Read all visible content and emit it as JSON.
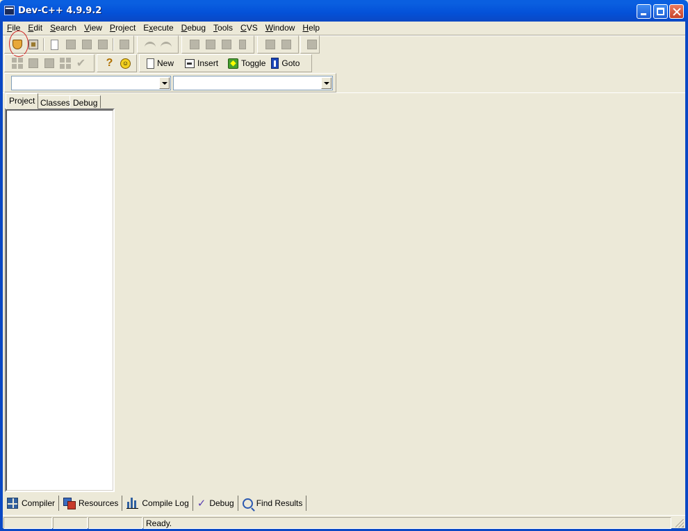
{
  "window": {
    "title": "Dev-C++ 4.9.9.2"
  },
  "menubar": {
    "items": [
      {
        "label": "File",
        "u": "F",
        "rest": "ile"
      },
      {
        "label": "Edit",
        "u": "E",
        "rest": "dit"
      },
      {
        "label": "Search",
        "u": "S",
        "rest": "earch"
      },
      {
        "label": "View",
        "u": "V",
        "rest": "iew"
      },
      {
        "label": "Project",
        "u": "P",
        "rest": "roject"
      },
      {
        "label": "Execute",
        "u": "x",
        "pre": "E",
        "rest": "ecute"
      },
      {
        "label": "Debug",
        "u": "D",
        "rest": "ebug"
      },
      {
        "label": "Tools",
        "u": "T",
        "rest": "ools"
      },
      {
        "label": "CVS",
        "u": "C",
        "rest": "VS"
      },
      {
        "label": "Window",
        "u": "W",
        "rest": "indow"
      },
      {
        "label": "Help",
        "u": "H",
        "rest": "elp"
      }
    ]
  },
  "toolbar2": {
    "new_label": "New",
    "insert_label": "Insert",
    "toggle_label": "Toggle",
    "goto_label": "Goto"
  },
  "combos": {
    "class_value": "",
    "member_value": ""
  },
  "left_tabs": {
    "project": "Project",
    "classes": "Classes",
    "debug": "Debug",
    "active": "Project"
  },
  "bottom_tabs": {
    "compiler": "Compiler",
    "resources": "Resources",
    "compile_log": "Compile Log",
    "debug": "Debug",
    "find_results": "Find Results"
  },
  "statusbar": {
    "panel1": "",
    "panel2": "",
    "panel3": "",
    "message": "Ready."
  },
  "colors": {
    "titlebar": "#0a5fe0",
    "face": "#ece9d8",
    "annotation": "#d02020"
  }
}
